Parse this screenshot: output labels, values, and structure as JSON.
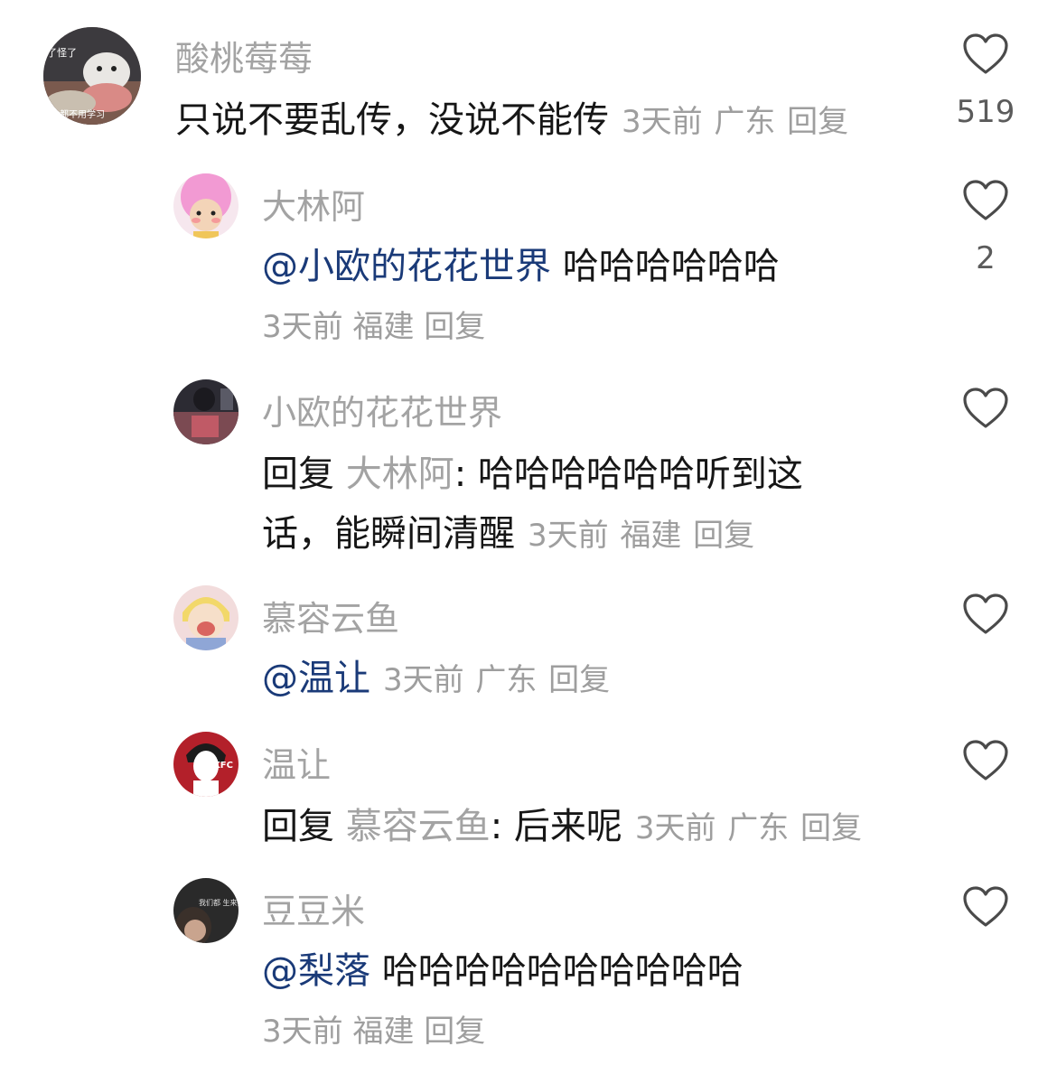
{
  "comments": [
    {
      "username": "酸桃莓莓",
      "text": "只说不要乱传，没说不能传",
      "time": "3天前",
      "location": "广东",
      "reply_label": "回复",
      "like_count": "519",
      "avatar_text_top": "了怪了",
      "avatar_text_bottom": "都不用学习"
    },
    {
      "username": "大林阿",
      "mention": "@小欧的花花世界",
      "text": "哈哈哈哈哈哈",
      "time": "3天前",
      "location": "福建",
      "reply_label": "回复",
      "like_count": "2"
    },
    {
      "username": "小欧的花花世界",
      "reply_prefix": "回复",
      "reply_to": "大林阿",
      "colon": ":",
      "text_line1": "哈哈哈哈哈哈听到这",
      "text_line2": "话，能瞬间清醒",
      "time": "3天前",
      "location": "福建",
      "reply_label": "回复"
    },
    {
      "username": "慕容云鱼",
      "mention": "@温让",
      "time": "3天前",
      "location": "广东",
      "reply_label": "回复"
    },
    {
      "username": "温让",
      "reply_prefix": "回复",
      "reply_to": "慕容云鱼",
      "colon": ":",
      "text": "后来呢",
      "time": "3天前",
      "location": "广东",
      "reply_label": "回复",
      "avatar_text": "KFC"
    },
    {
      "username": "豆豆米",
      "mention": "@梨落",
      "text": "哈哈哈哈哈哈哈哈哈哈",
      "time": "3天前",
      "location": "福建",
      "reply_label": "回复",
      "avatar_text": "我们都 生来孤独"
    }
  ],
  "colors": {
    "mention": "#1a3a78",
    "username": "#a3a3a3",
    "meta": "#9e9e9e",
    "text": "#161616"
  },
  "icons": {
    "like": "heart-outline-icon"
  }
}
